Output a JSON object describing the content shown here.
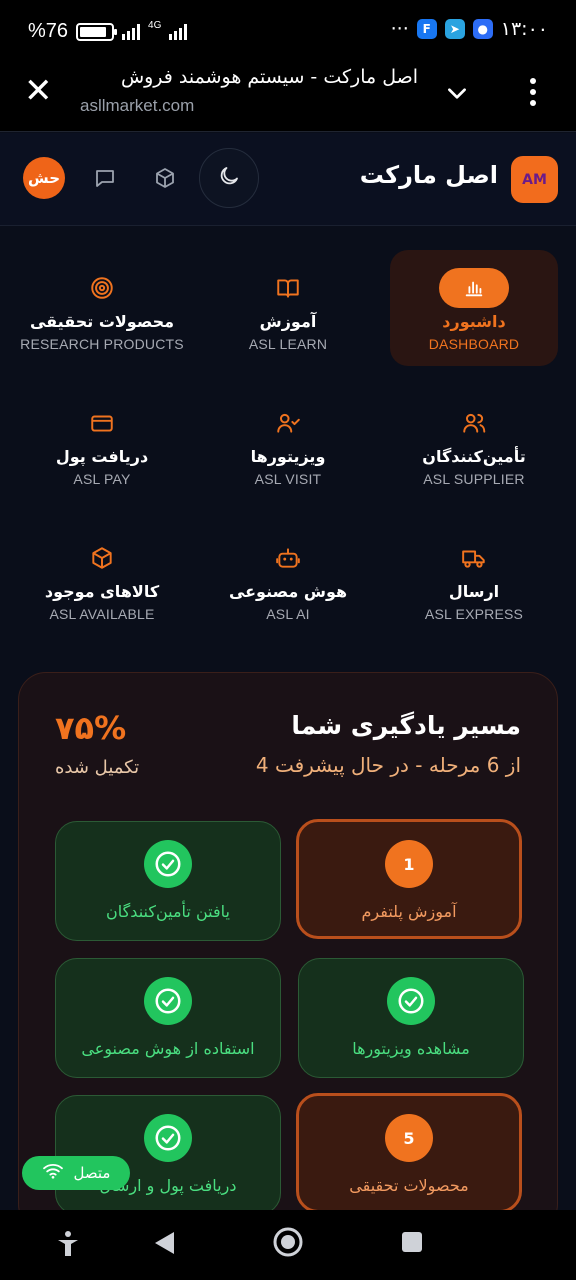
{
  "status": {
    "battery": "%76",
    "network": "4G",
    "time": "۱۳:۰۰",
    "dots": "···"
  },
  "browser": {
    "title": "اصل مارکت - سیستم هوشمند فروش",
    "url": "asllmarket.com"
  },
  "header": {
    "brand": "اصل مارکت",
    "logo_text": "AM",
    "avatar_text": "حش"
  },
  "nav": [
    {
      "label": "داشبورد",
      "sub": "DASHBOARD",
      "icon": "bar-chart-icon",
      "active": true
    },
    {
      "label": "آموزش",
      "sub": "ASL LEARN",
      "icon": "book-icon"
    },
    {
      "label": "محصولات تحقیقی",
      "sub": "RESEARCH PRODUCTS",
      "icon": "target-icon"
    },
    {
      "label": "تأمین‌کنندگان",
      "sub": "ASL SUPPLIER",
      "icon": "users-icon"
    },
    {
      "label": "ویزیتورها",
      "sub": "ASL VISIT",
      "icon": "user-check-icon"
    },
    {
      "label": "دریافت پول",
      "sub": "ASL PAY",
      "icon": "credit-card-icon"
    },
    {
      "label": "ارسال",
      "sub": "ASL EXPRESS",
      "icon": "truck-icon"
    },
    {
      "label": "هوش مصنوعی",
      "sub": "ASL AI",
      "icon": "robot-icon"
    },
    {
      "label": "کالاهای موجود",
      "sub": "ASL AVAILABLE",
      "icon": "box-icon"
    }
  ],
  "learning": {
    "title": "مسیر یادگیری شما",
    "subtitle": "4 از 6 مرحله - در حال پیشرفت",
    "percent": "۷۵%",
    "percent_label": "تکمیل شده",
    "steps": [
      {
        "label": "آموزش پلتفرم",
        "status": "todo",
        "number": "1"
      },
      {
        "label": "یافتن تأمین‌کنندگان",
        "status": "done"
      },
      {
        "label": "مشاهده ویزیتورها",
        "status": "done"
      },
      {
        "label": "استفاده از هوش مصنوعی",
        "status": "done"
      },
      {
        "label": "محصولات تحقیقی",
        "status": "todo",
        "number": "5"
      },
      {
        "label": "دریافت پول و ارسال",
        "status": "done"
      }
    ]
  },
  "connection": {
    "label": "متصل"
  },
  "colors": {
    "accent": "#f0731f",
    "success": "#22c55e",
    "background": "#0a0e1a"
  }
}
